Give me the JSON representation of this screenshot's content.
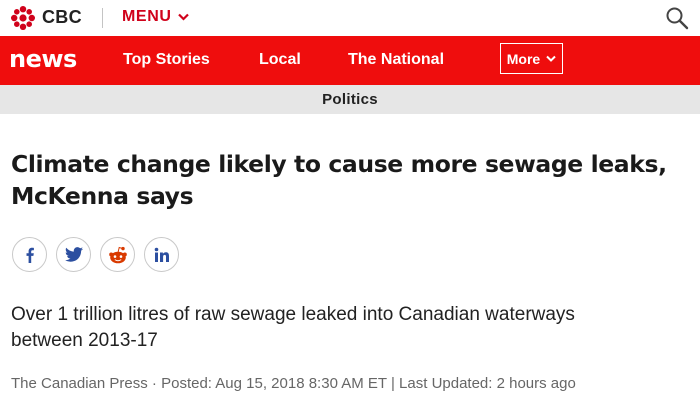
{
  "header": {
    "brand": "CBC",
    "menu_label": "MENU",
    "brand_color": "#d0021b",
    "icons": {
      "logo": "cbc-gem-icon",
      "menu": "chevron-down-icon",
      "search": "search-icon"
    }
  },
  "nav": {
    "logo_text": "news",
    "items": [
      {
        "label": "Top Stories"
      },
      {
        "label": "Local"
      },
      {
        "label": "The National"
      }
    ],
    "more_label": "More",
    "background_color": "#ef0d0d"
  },
  "section": {
    "label": "Politics"
  },
  "article": {
    "headline": "Climate change likely to cause more sewage leaks, McKenna says",
    "deck": "Over 1 trillion litres of raw sewage leaked into Canadian waterways between 2013-17",
    "byline": {
      "source": "The Canadian Press",
      "separator_1": " · ",
      "posted": "Posted: Aug 15, 2018 8:30 AM ET",
      "separator_2": " | ",
      "updated": "Last Updated: 2 hours ago"
    }
  },
  "share": {
    "icons": [
      "facebook-icon",
      "twitter-icon",
      "reddit-icon",
      "linkedin-icon"
    ],
    "icon_color": "#2c4fa0"
  }
}
